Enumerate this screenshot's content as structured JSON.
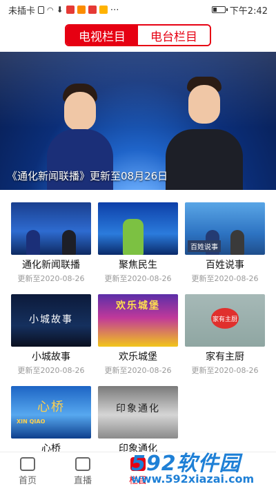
{
  "status_bar": {
    "carrier": "未插卡",
    "time": "下午2:42",
    "battery_level": 0.3
  },
  "tabs": [
    {
      "label": "电视栏目",
      "active": true
    },
    {
      "label": "电台栏目",
      "active": false
    }
  ],
  "banner": {
    "caption": "《通化新闻联播》更新至08月26日"
  },
  "programs": [
    {
      "name": "通化新闻联播",
      "updated": "更新至2020-08-26",
      "thumb": "th-news"
    },
    {
      "name": "聚焦民生",
      "updated": "更新至2020-08-26",
      "thumb": "th-jujiao"
    },
    {
      "name": "百姓说事",
      "updated": "更新至2020-08-26",
      "thumb": "th-baixing"
    },
    {
      "name": "小城故事",
      "updated": "更新至2020-08-26",
      "thumb": "th-xiaocheng"
    },
    {
      "name": "欢乐城堡",
      "updated": "更新至2020-08-26",
      "thumb": "th-huanle"
    },
    {
      "name": "家有主厨",
      "updated": "更新至2020-08-26",
      "thumb": "th-jiayou"
    },
    {
      "name": "心桥",
      "updated": "",
      "thumb": "th-xiaoqiao"
    },
    {
      "name": "印象通化",
      "updated": "",
      "thumb": "th-yinxiang"
    }
  ],
  "thumb_text": {
    "xiaocheng": "小城故事",
    "huanle": "欢乐城堡",
    "jiayou": "家有主厨",
    "xiaoqiao": "心桥",
    "xiaoqiao_en": "XIN QIAO",
    "yinxiang": "印象通化",
    "baixing": "百姓说事"
  },
  "bottom_nav": [
    {
      "label": "首页",
      "icon": "home-doc-icon",
      "active": false
    },
    {
      "label": "直播",
      "icon": "live-play-icon",
      "active": false
    },
    {
      "label": "栏目",
      "icon": "column-icon",
      "active": true
    }
  ],
  "watermark": {
    "logo": "592软件园",
    "url": "www.592xiazai.com"
  },
  "colors": {
    "accent": "#e60012",
    "watermark": "#1f80d6"
  }
}
